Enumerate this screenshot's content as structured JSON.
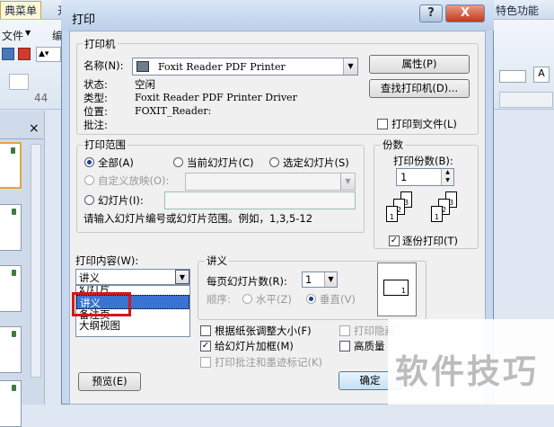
{
  "app": {
    "tabs": [
      "典菜单",
      "开",
      "",
      "",
      "",
      "特色功能"
    ],
    "ribbon_labels": [
      "文件",
      "编"
    ],
    "font_size": "44"
  },
  "dialog": {
    "title": "打印",
    "help": "?",
    "close": "X",
    "printer": {
      "group": "打印机",
      "name_label": "名称(N):",
      "name_value": "Foxit Reader PDF Printer",
      "status_label": "状态:",
      "status_value": "空闲",
      "type_label": "类型:",
      "type_value": "Foxit Reader PDF Printer Driver",
      "where_label": "位置:",
      "where_value": "FOXIT_Reader:",
      "comment_label": "批注:",
      "properties_button": "属性(P)",
      "find_button": "查找打印机(D)...",
      "print_to_file": "打印到文件(L)"
    },
    "range": {
      "group": "打印范围",
      "all": "全部(A)",
      "current": "当前幻灯片(C)",
      "selection": "选定幻灯片(S)",
      "custom": "自定义放映(O):",
      "slides": "幻灯片(I):",
      "hint": "请输入幻灯片编号或幻灯片范围。例如，1,3,5-12"
    },
    "copies": {
      "group": "份数",
      "label": "打印份数(B):",
      "value": "1",
      "collate": "逐份打印(T)",
      "page_labels": [
        "1",
        "2",
        "3",
        "1",
        "2",
        "3"
      ]
    },
    "content": {
      "label": "打印内容(W):",
      "value": "讲义",
      "options": [
        "幻灯片",
        "讲义",
        "备注页",
        "大纲视图"
      ],
      "selected_index": 1
    },
    "handouts": {
      "group": "讲义",
      "per_page_label": "每页幻灯片数(R):",
      "per_page_value": "1",
      "order_label": "顺序:",
      "horizontal": "水平(Z)",
      "vertical": "垂直(V)",
      "preview_page": "1"
    },
    "options": {
      "scale": "根据纸张调整大小(F)",
      "frame": "给幻灯片加框(M)",
      "print_comments": "打印批注和墨迹标记(K)",
      "print_hidden": "打印隐藏",
      "high_quality": "高质量"
    },
    "preview_button": "预览(E)",
    "ok_button": "确定"
  },
  "watermark": "软件技巧"
}
